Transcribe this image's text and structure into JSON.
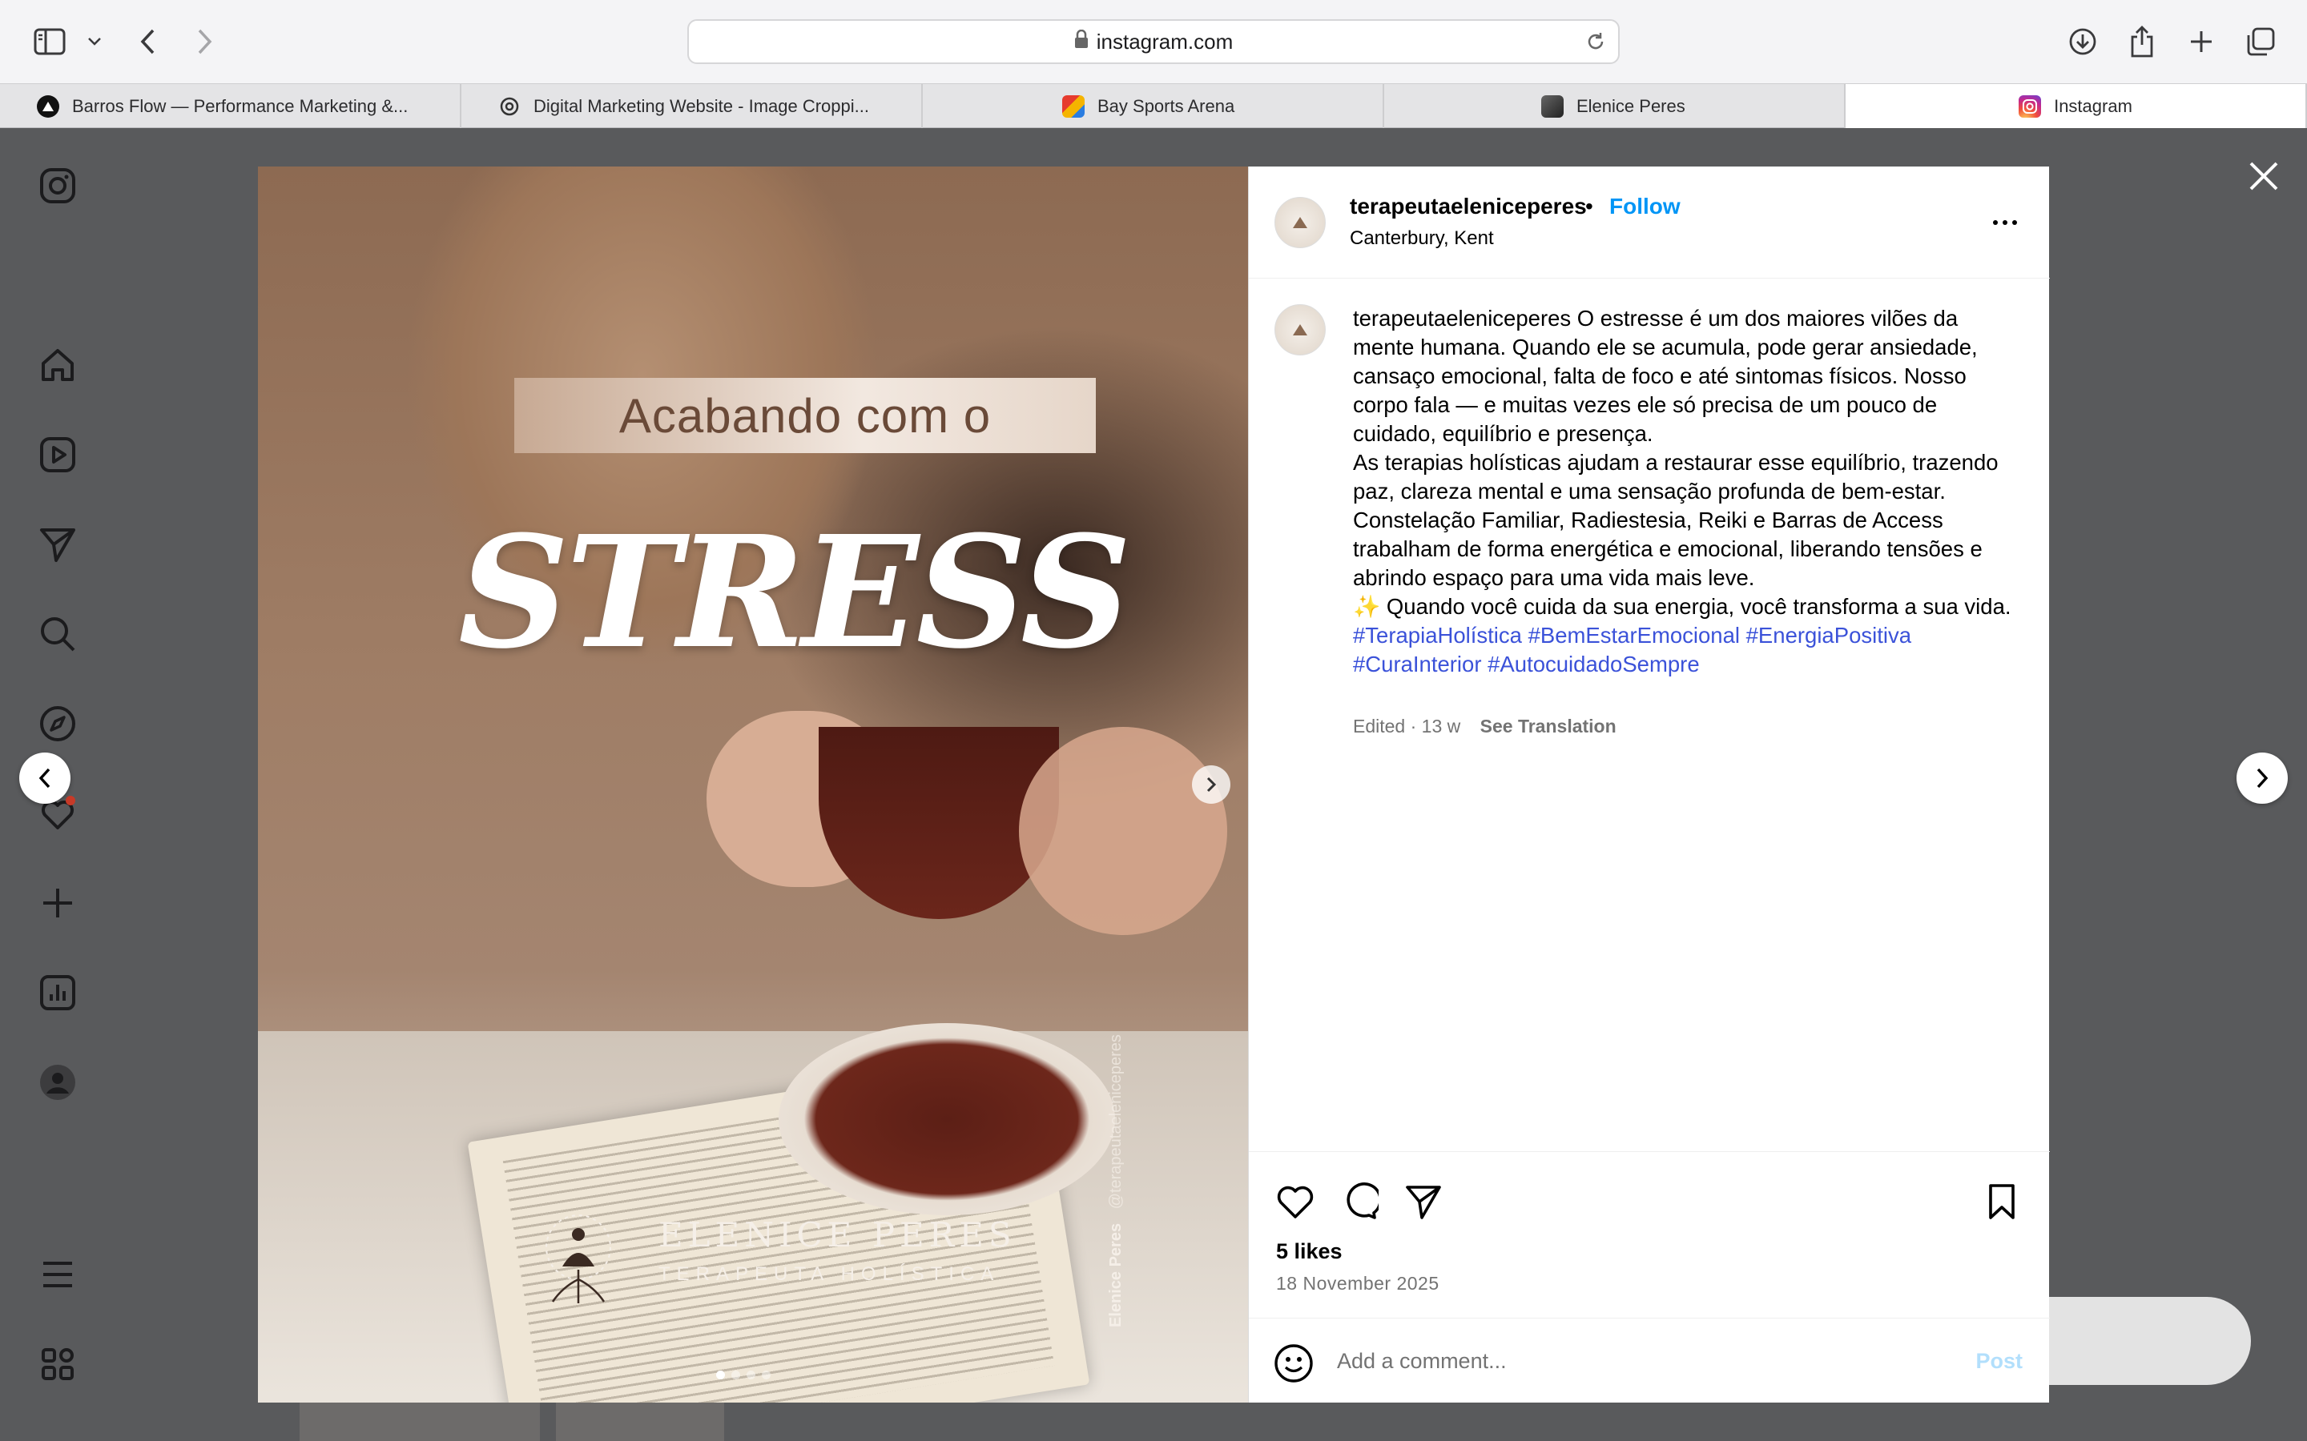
{
  "browser": {
    "url": "instagram.com",
    "tabs": [
      {
        "label": "Barros Flow — Performance Marketing &...",
        "icon": "triangle-logo-icon"
      },
      {
        "label": "Digital Marketing Website - Image Croppi...",
        "icon": "openai-logo-icon"
      },
      {
        "label": "Bay Sports Arena",
        "icon": "colorful-logo-icon"
      },
      {
        "label": "Elenice Peres",
        "icon": "cube-logo-icon"
      },
      {
        "label": "Instagram",
        "icon": "instagram-logo-icon"
      }
    ]
  },
  "sidebar": [
    "instagram-logo-icon",
    "home-icon",
    "reels-icon",
    "direct-icon",
    "search-icon",
    "explore-icon",
    "notifications-icon",
    "create-icon",
    "dashboard-icon",
    "profile-icon",
    "menu-icon",
    "threads-icon"
  ],
  "post": {
    "media": {
      "headline": "Acabando com o",
      "title": "STRESS",
      "brand_name": "ELENICE PERES",
      "brand_sub": "TERAPEUTA HOLÍSTICA",
      "credit_name": "Elenice Peres",
      "credit_handle": "@terapeutaeleniceperes",
      "slide_count": 4,
      "active_slide": 1
    },
    "header": {
      "username": "terapeutaeleniceperes",
      "separator": "•",
      "follow": "Follow",
      "location": "Canterbury, Kent"
    },
    "caption": {
      "username": "terapeutaeleniceperes",
      "paragraph1": "O estresse é um dos maiores vilões da mente humana. Quando ele se acumula, pode gerar ansiedade, cansaço emocional, falta de foco e até sintomas físicos. Nosso corpo fala — e muitas vezes ele só precisa de um pouco de cuidado, equilíbrio e presença.",
      "paragraph2": "As terapias holísticas ajudam a restaurar esse equilíbrio, trazendo paz, clareza mental e uma sensação profunda de bem-estar.",
      "paragraph3": "Constelação Familiar, Radiestesia, Reiki e Barras de Access trabalham de forma energética e emocional, liberando tensões e abrindo espaço para uma vida mais leve.",
      "paragraph4": "✨ Quando você cuida da sua energia, você transforma a sua vida.",
      "hashtags": [
        "#TerapiaHolística",
        "#BemEstarEmocional",
        "#EnergiaPositiva",
        "#CuraInterior",
        "#AutocuidadoSempre"
      ]
    },
    "meta": {
      "edited": "Edited · 13 w",
      "see_translation": "See Translation"
    },
    "likes": "5 likes",
    "date": "18 November 2025",
    "comment": {
      "placeholder": "Add a comment...",
      "post": "Post"
    }
  }
}
